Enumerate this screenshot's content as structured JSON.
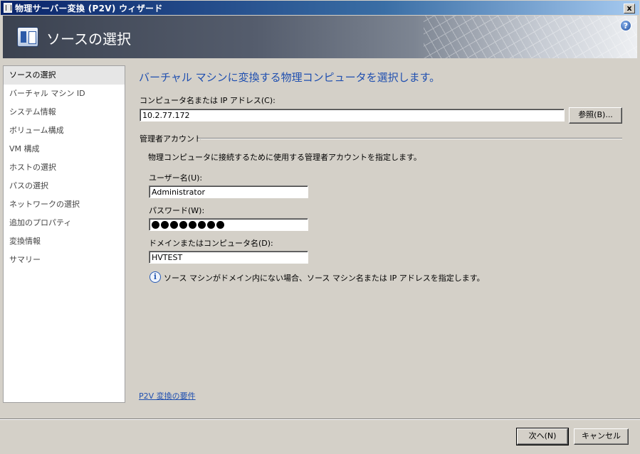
{
  "window": {
    "title": "物理サーバー変換 (P2V) ウィザード",
    "close_label": "x"
  },
  "header": {
    "title": "ソースの選択",
    "help_label": "?"
  },
  "sidebar": {
    "items": [
      {
        "label": "ソースの選択"
      },
      {
        "label": "バーチャル マシン ID"
      },
      {
        "label": "システム情報"
      },
      {
        "label": "ボリューム構成"
      },
      {
        "label": "VM 構成"
      },
      {
        "label": "ホストの選択"
      },
      {
        "label": "パスの選択"
      },
      {
        "label": "ネットワークの選択"
      },
      {
        "label": "追加のプロパティ"
      },
      {
        "label": "変換情報"
      },
      {
        "label": "サマリー"
      }
    ]
  },
  "main": {
    "heading": "バーチャル マシンに変換する物理コンピュータを選択します。",
    "computer_label": "コンピュータ名または IP アドレス(C):",
    "computer_value": "10.2.77.172",
    "browse_label": "参照(B)...",
    "admin_section": "管理者アカウント",
    "admin_description": "物理コンピュータに接続するために使用する管理者アカウントを指定します。",
    "username_label": "ユーザー名(U):",
    "username_value": "Administrator",
    "password_label": "パスワード(W):",
    "password_masked_length": 8,
    "domain_label": "ドメインまたはコンピュータ名(D):",
    "domain_value": "HVTEST",
    "info_text": "ソース マシンがドメイン内にない場合、ソース マシン名または IP アドレスを指定します。",
    "requirements_link": "P2V 変換の要件"
  },
  "footer": {
    "next_label": "次へ(N)",
    "cancel_label": "キャンセル"
  }
}
